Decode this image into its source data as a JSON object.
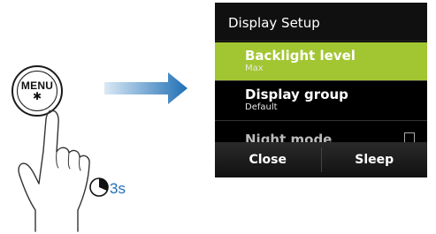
{
  "menu_button": {
    "label": "MENU",
    "icon": "sun-icon"
  },
  "timer": {
    "label": "3s",
    "icon": "timer-icon",
    "color": "#1f6fb5"
  },
  "arrow": {
    "color_start": "#dbe9f5",
    "color_end": "#1f6fb5"
  },
  "screen": {
    "title": "Display Setup",
    "items": [
      {
        "label": "Backlight level",
        "value": "Max",
        "selected": true
      },
      {
        "label": "Display group",
        "value": "Default",
        "selected": false
      }
    ],
    "partial_item": {
      "label": "Night mode",
      "checkbox": "checkbox-icon"
    },
    "softkeys": {
      "left": "Close",
      "right": "Sleep"
    },
    "accent": "#a2c632"
  }
}
